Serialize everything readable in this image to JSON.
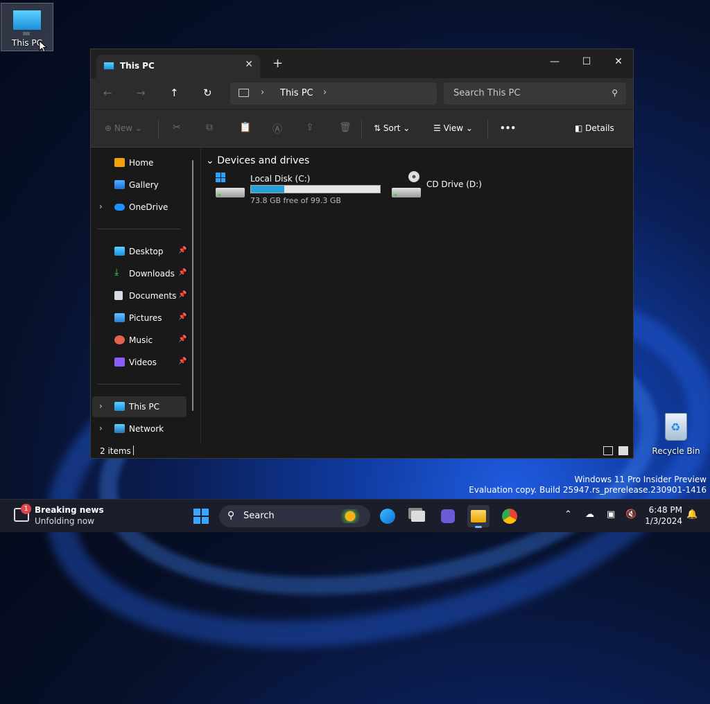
{
  "desktop": {
    "this_pc_label": "This PC",
    "recycle_bin_label": "Recycle Bin",
    "watermark_line1": "Windows 11 Pro Insider Preview",
    "watermark_line2": "Evaluation copy. Build 25947.rs_prerelease.230901-1416"
  },
  "explorer": {
    "tab_title": "This PC",
    "address": {
      "location": "This PC"
    },
    "search": {
      "placeholder": "Search This PC"
    },
    "toolbar": {
      "new_label": "New",
      "sort_label": "Sort",
      "view_label": "View",
      "details_label": "Details",
      "more_label": "•••"
    },
    "sidebar": {
      "top": [
        {
          "label": "Home"
        },
        {
          "label": "Gallery"
        },
        {
          "label": "OneDrive"
        }
      ],
      "pinned": [
        {
          "label": "Desktop"
        },
        {
          "label": "Downloads"
        },
        {
          "label": "Documents"
        },
        {
          "label": "Pictures"
        },
        {
          "label": "Music"
        },
        {
          "label": "Videos"
        }
      ],
      "bottom": [
        {
          "label": "This PC"
        },
        {
          "label": "Network"
        }
      ]
    },
    "content": {
      "group_title": "Devices and drives",
      "drives": [
        {
          "name": "Local Disk (C:)",
          "free_text": "73.8 GB free of 99.3 GB",
          "used_fraction": 0.257
        },
        {
          "name": "CD Drive (D:)"
        }
      ]
    },
    "status": {
      "items_text": "2 items"
    }
  },
  "taskbar": {
    "news_title": "Breaking news",
    "news_subtitle": "Unfolding now",
    "news_badge": "1",
    "search_label": "Search",
    "clock_time": "6:48 PM",
    "clock_date": "1/3/2024"
  },
  "colors": {
    "accent": "#26a0da",
    "window_bg": "#191919",
    "toolbar_bg": "#2c2c2c"
  }
}
